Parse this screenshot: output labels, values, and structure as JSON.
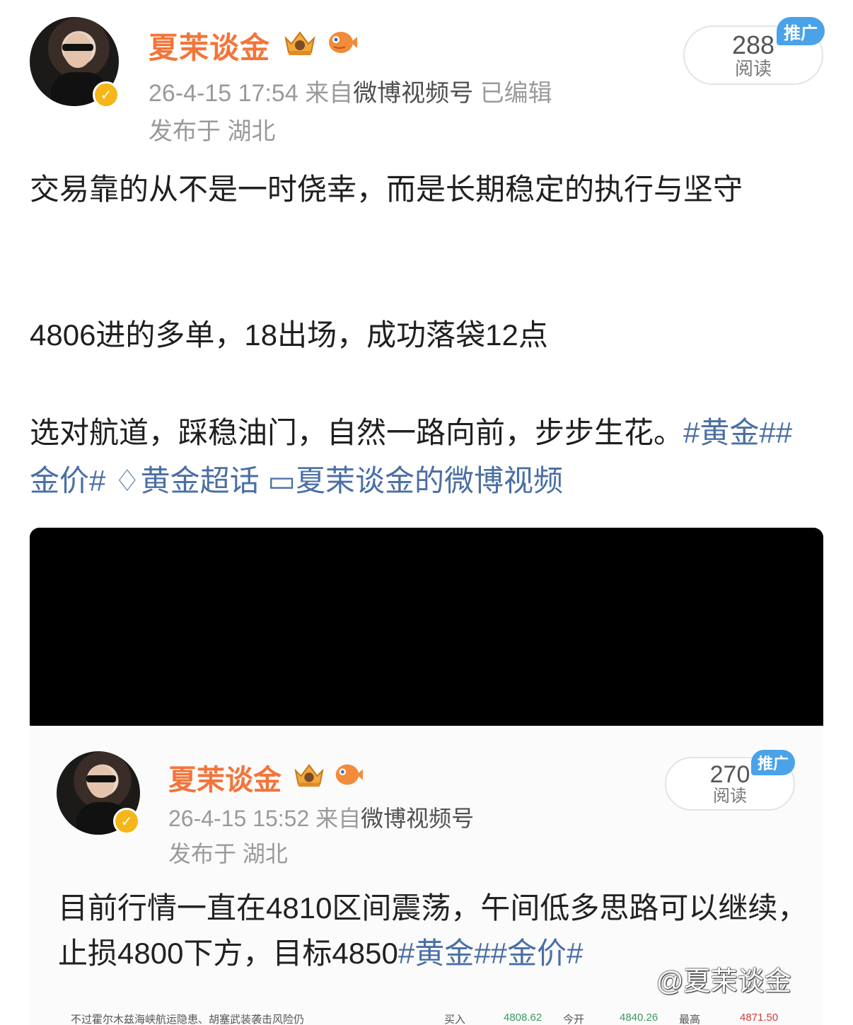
{
  "post": {
    "username": "夏茉谈金",
    "timestamp": "26-4-15 17:54",
    "source_prefix": "来自",
    "source": "微博视频号",
    "edited": "已编辑",
    "location": "发布于 湖北",
    "read_count": "288",
    "read_label": "阅读",
    "promo_tag": "推广",
    "paragraph1": "交易靠的从不是一时侥幸，而是长期稳定的执行与坚守",
    "paragraph2": "4806进的多单，18出场，成功落袋12点",
    "paragraph3_text": "选对航道，踩稳油门，自然一路向前，步步生花。",
    "hashtags": "#黄金##金价#",
    "supertopic": "♢黄金超话",
    "video_link": "▭夏茉谈金的微博视频"
  },
  "embedded": {
    "username": "夏茉谈金",
    "timestamp": "26-4-15 15:52",
    "source_prefix": "来自",
    "source": "微博视频号",
    "location": "发布于 湖北",
    "read_count": "270",
    "read_label": "阅读",
    "promo_tag": "推广",
    "text": "目前行情一直在4810区间震荡，午间低多思路可以继续，止损4800下方，目标4850",
    "hashtags": "#黄金##金价#",
    "ticker": {
      "headline": "不过霍尔木兹海峡航运隐患、胡塞武装袭击风险仍",
      "buy_label": "买入",
      "buy_value": "4808.62",
      "open_label": "今开",
      "open_value": "4840.26",
      "high_label": "最高",
      "high_value": "4871.50"
    }
  },
  "watermark": "@夏茉谈金",
  "colors": {
    "username": "#f2753a",
    "link": "#4a6fa5",
    "promo": "#4aa2e8",
    "verified": "#f5b619"
  }
}
